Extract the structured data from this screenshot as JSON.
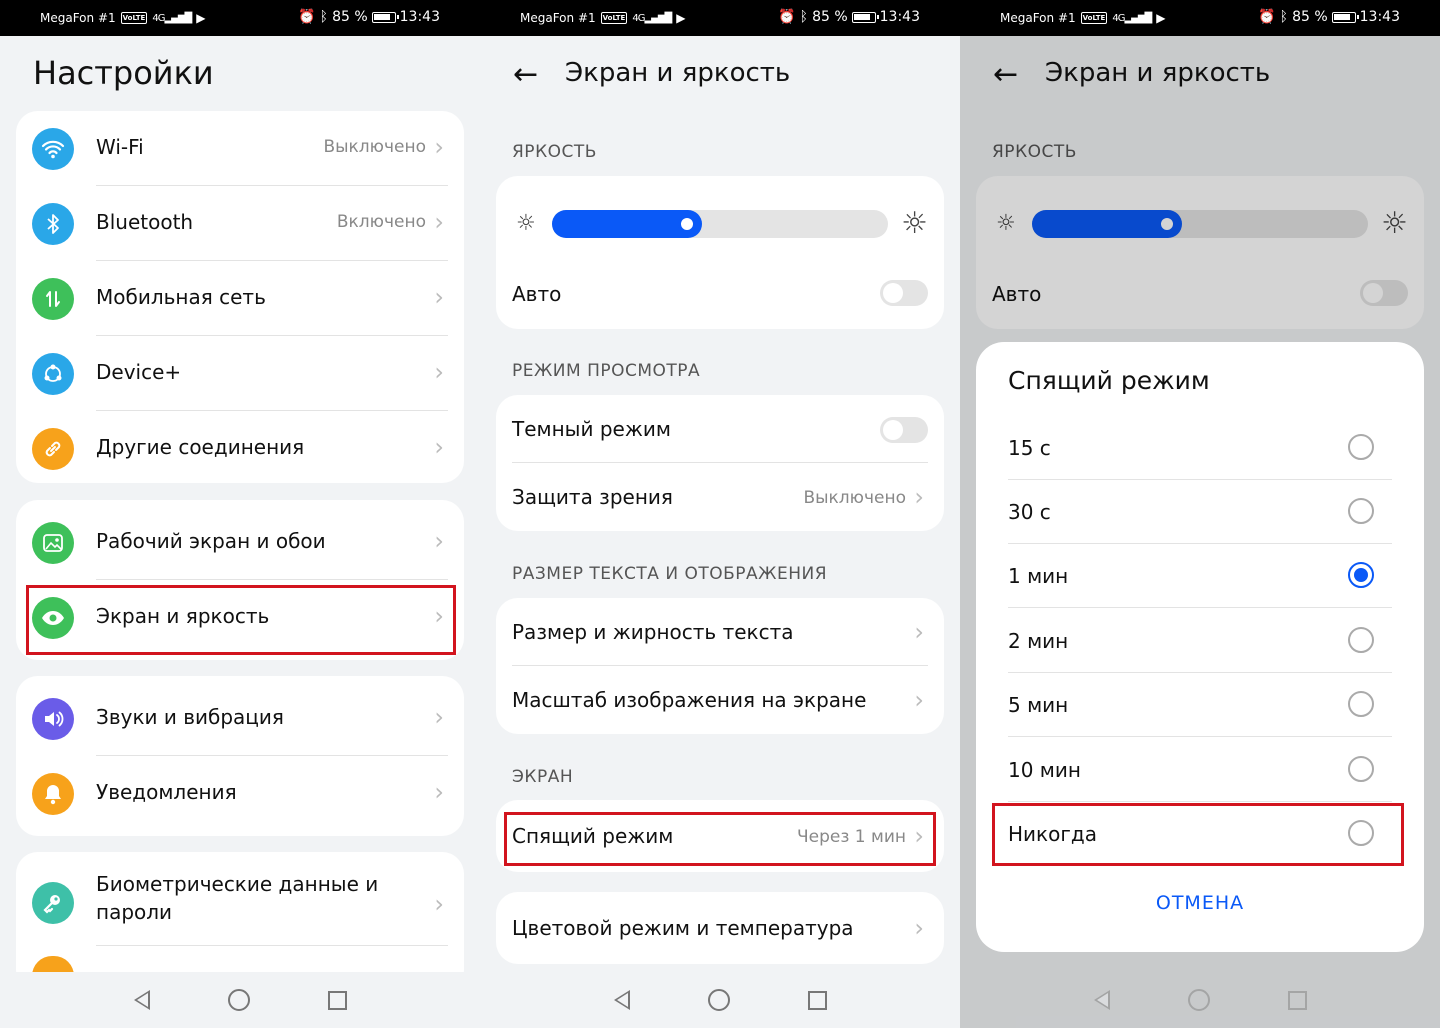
{
  "status_bar": {
    "carrier": "MegaFon #1",
    "volte": "VoLTE",
    "network": "4G",
    "battery": "85 %",
    "time": "13:43"
  },
  "screen1": {
    "title": "Настройки",
    "group1": [
      {
        "label": "Wi-Fi",
        "value": "Выключено",
        "icon": "wifi-icon",
        "color": "#2aa7e8"
      },
      {
        "label": "Bluetooth",
        "value": "Включено",
        "icon": "bluetooth-icon",
        "color": "#2aa7e8"
      },
      {
        "label": "Мобильная сеть",
        "value": "",
        "icon": "mobile-data-icon",
        "color": "#3ec05a"
      },
      {
        "label": "Device+",
        "value": "",
        "icon": "device-plus-icon",
        "color": "#2aa7e8"
      },
      {
        "label": "Другие соединения",
        "value": "",
        "icon": "link-icon",
        "color": "#f7a21b"
      }
    ],
    "group2": [
      {
        "label": "Рабочий экран и обои",
        "icon": "wallpaper-icon",
        "color": "#3ec05a"
      },
      {
        "label": "Экран и яркость",
        "icon": "eye-icon",
        "color": "#3ec05a"
      }
    ],
    "group3": [
      {
        "label": "Звуки и вибрация",
        "icon": "sound-icon",
        "color": "#6a5ce8"
      },
      {
        "label": "Уведомления",
        "icon": "bell-icon",
        "color": "#f7a21b"
      }
    ],
    "group4": [
      {
        "label": "Биометрические данные и",
        "label2": "пароли",
        "icon": "key-icon",
        "color": "#3ec0a8"
      }
    ]
  },
  "screen2": {
    "title": "Экран и яркость",
    "brightness_section": "ЯРКОСТЬ",
    "brightness_level": 0.41,
    "auto_label": "Авто",
    "view_section": "РЕЖИМ ПРОСМОТРА",
    "dark_mode": "Темный режим",
    "eye_comfort": "Защита зрения",
    "eye_comfort_value": "Выключено",
    "text_section": "РАЗМЕР ТЕКСТА И ОТОБРАЖЕНИЯ",
    "text_size": "Размер и жирность текста",
    "display_scale": "Масштаб изображения на экране",
    "screen_section": "ЭКРАН",
    "sleep": "Спящий режим",
    "sleep_value": "Через 1 мин",
    "color_mode": "Цветовой режим и температура"
  },
  "screen3": {
    "dialog_title": "Спящий режим",
    "options": [
      "15 с",
      "30 с",
      "1 мин",
      "2 мин",
      "5 мин",
      "10 мин",
      "Никогда"
    ],
    "selected_index": 2,
    "cancel": "ОТМЕНА"
  },
  "colors": {
    "accent": "#0a59f7",
    "highlight": "#d2141e"
  }
}
